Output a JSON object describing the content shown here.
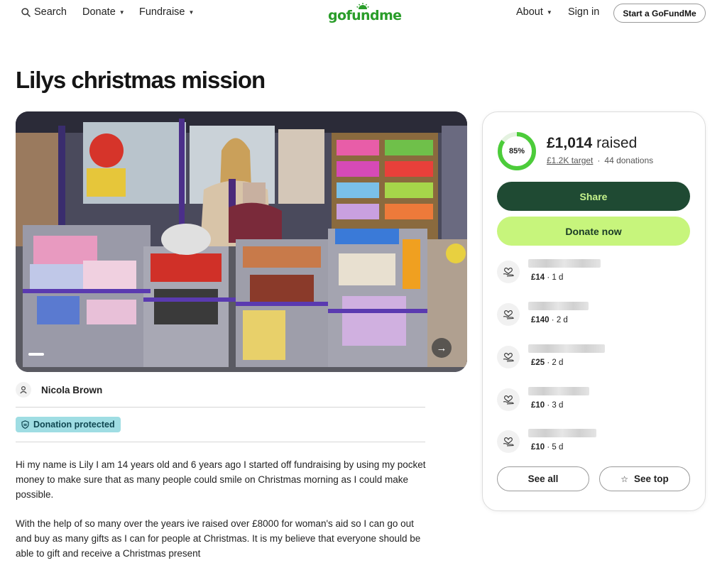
{
  "header": {
    "search_label": "Search",
    "donate_label": "Donate",
    "fundraise_label": "Fundraise",
    "logo_text": "gofundme",
    "about_label": "About",
    "signin_label": "Sign in",
    "start_label": "Start a GoFundMe"
  },
  "campaign": {
    "title": "Lilys christmas mission",
    "organizer_name": "Nicola Brown",
    "protection_badge": "Donation protected",
    "story": [
      "Hi my name is Lily I am 14 years old and 6 years ago I started off fundraising by using my pocket money to make sure that as many people could smile on Christmas morning as I could make possible.",
      "With the help of so many over the years ive raised over £8000 for woman's aid so I can go out and buy as many gifts as I can for people at Christmas. It is my believe that everyone should be able to gift and receive a Christmas present"
    ]
  },
  "card": {
    "progress_percent": 85,
    "progress_label": "85%",
    "raised_amount": "£1,014",
    "raised_suffix": " raised",
    "target_label": "£1.2K target",
    "separator": "·",
    "donation_count": "44 donations",
    "share_label": "Share",
    "donate_now_label": "Donate now",
    "donations": [
      {
        "amount": "£14",
        "time": " · 1 d"
      },
      {
        "amount": "£140",
        "time": " · 2 d"
      },
      {
        "amount": "£25",
        "time": " · 2 d"
      },
      {
        "amount": "£10",
        "time": " · 3 d"
      },
      {
        "amount": "£10",
        "time": " · 5 d"
      }
    ],
    "see_all_label": "See all",
    "see_top_label": "See top"
  },
  "colors": {
    "brand_green": "#2a9d2a",
    "share_bg": "#1f4a33",
    "donate_bg": "#c7f57c",
    "progress": "#4ccc3a",
    "badge_bg": "#9fdde3"
  },
  "icons": [
    "search-icon",
    "caret-down-icon",
    "person-icon",
    "shield-icon",
    "heart-hand-icon",
    "chevron-right-icon",
    "star-icon"
  ]
}
